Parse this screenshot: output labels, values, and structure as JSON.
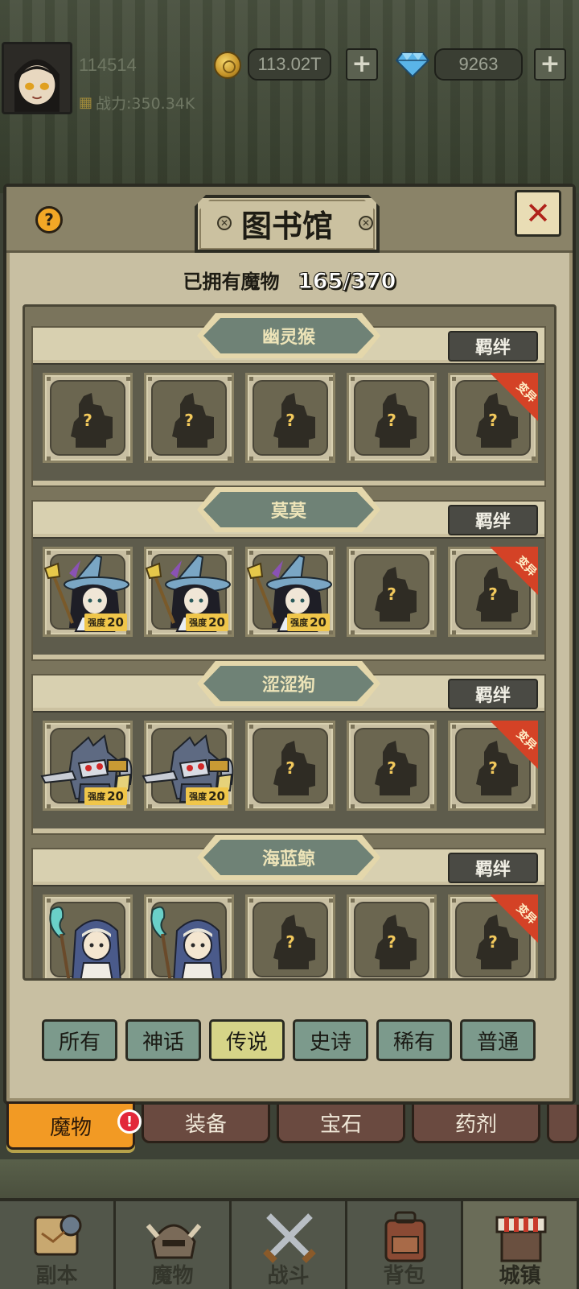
{
  "header": {
    "player_id": "114514",
    "power_label": "战力:350.34K",
    "gold": "113.02T",
    "gems": "9263",
    "gold_plus": "+",
    "gem_plus": "+"
  },
  "panel": {
    "title": "图书馆",
    "help": "?",
    "close": "✕",
    "owned_label": "已拥有魔物",
    "owned_count": "165/370",
    "unknown_mark": "?",
    "mutation_label": "变异",
    "strength_label": "强度",
    "groups": [
      {
        "name": "幽灵猴",
        "bond": "羁绊",
        "owned": 0,
        "strengths": []
      },
      {
        "name": "莫莫",
        "bond": "羁绊",
        "owned": 3,
        "strengths": [
          "20",
          "20",
          "20"
        ]
      },
      {
        "name": "涩涩狗",
        "bond": "羁绊",
        "owned": 2,
        "strengths": [
          "20",
          "20"
        ]
      },
      {
        "name": "海蓝鲸",
        "bond": "羁绊",
        "owned": 2,
        "strengths": []
      }
    ],
    "filters": [
      "所有",
      "神话",
      "传说",
      "史诗",
      "稀有",
      "普通"
    ],
    "active_filter": "传说"
  },
  "category_tabs": {
    "items": [
      "魔物",
      "装备",
      "宝石",
      "药剂"
    ],
    "active": "魔物",
    "alert": "!"
  },
  "bottom_nav": {
    "items": [
      {
        "label": "副本",
        "icon": "map-icon"
      },
      {
        "label": "魔物",
        "icon": "monster-helmet-icon"
      },
      {
        "label": "战斗",
        "icon": "crossed-swords-icon"
      },
      {
        "label": "背包",
        "icon": "backpack-icon"
      },
      {
        "label": "城镇",
        "icon": "shop-stall-icon"
      }
    ],
    "active": "城镇"
  },
  "colors": {
    "active_filter": "#d6d488",
    "filter": "#7c9a8c",
    "active_tab": "#f29a24",
    "mutation": "#d44226",
    "strength_badge": "#f0c64a"
  }
}
